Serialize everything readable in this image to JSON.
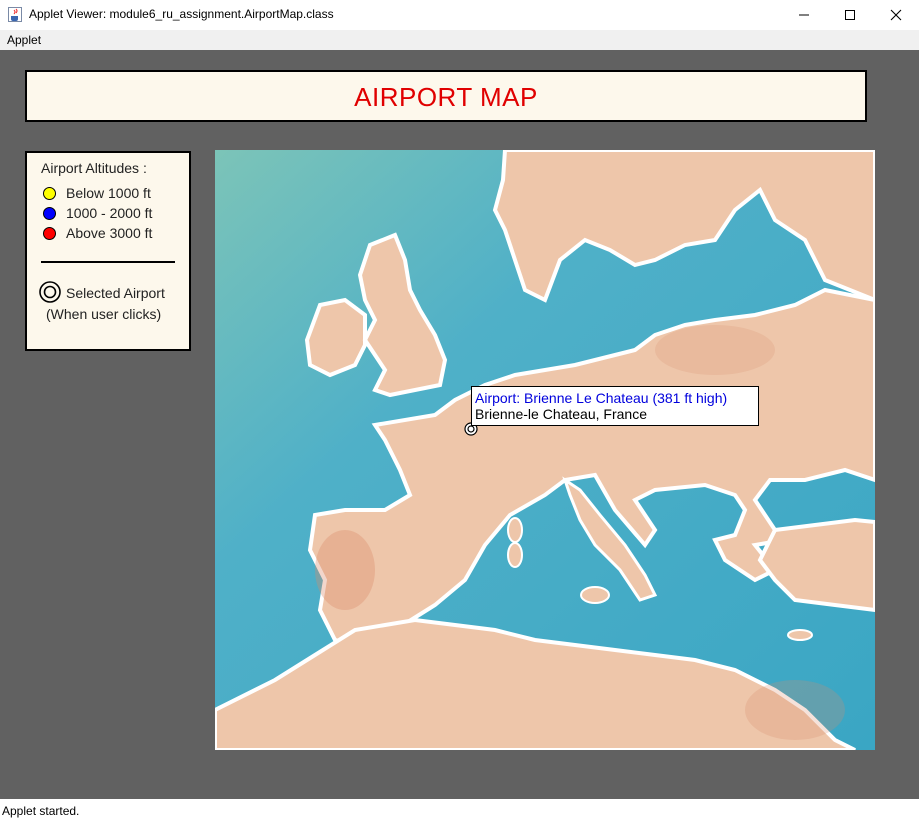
{
  "window": {
    "title": "Applet Viewer: module6_ru_assignment.AirportMap.class",
    "icon": "java-cup-icon",
    "controls": [
      "minimize-icon",
      "maximize-icon",
      "close-icon"
    ]
  },
  "menu": {
    "items": [
      {
        "label": "Applet"
      }
    ]
  },
  "header": {
    "title": "AIRPORT MAP",
    "title_color": "#e00000"
  },
  "legend": {
    "title": "Airport Altitudes :",
    "items": [
      {
        "label": "Below 1000 ft",
        "color": "#ffff00"
      },
      {
        "label": "1000 - 2000 ft",
        "color": "#0000ff"
      },
      {
        "label": "Above 3000 ft",
        "color": "#ff0000"
      }
    ],
    "selected_label": "Selected Airport",
    "selected_hint": "(When user clicks)"
  },
  "map": {
    "colors": {
      "sea": "#5bb5c9",
      "land": "#eec6aa",
      "coast": "#ffffff"
    },
    "tooltip": {
      "line1": "Airport: Brienne Le Chateau (381 ft high)",
      "line2": "Brienne-le Chateau, France",
      "line1_color": "#0000dd"
    }
  },
  "status": {
    "text": "Applet started."
  }
}
